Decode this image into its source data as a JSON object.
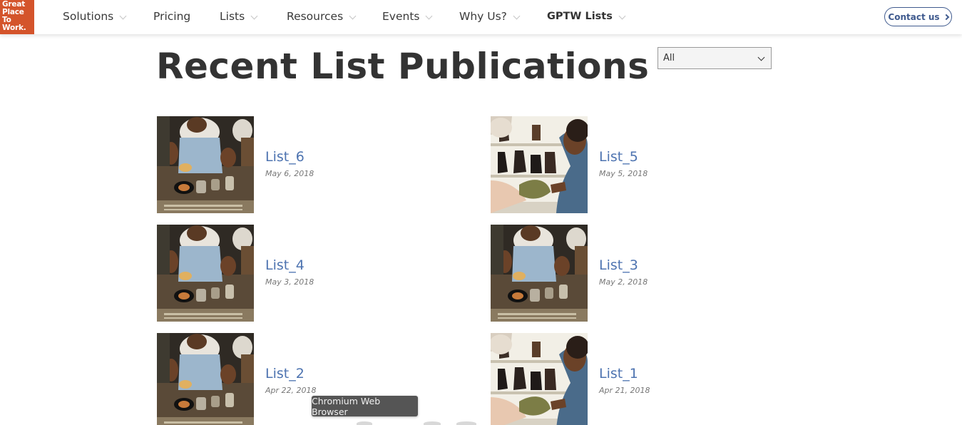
{
  "brand": {
    "logo_lines": [
      "Great",
      "Place",
      "To",
      "Work."
    ],
    "color": "#d4542b"
  },
  "nav": {
    "items": [
      {
        "label": "Solutions",
        "dropdown": true
      },
      {
        "label": "Pricing",
        "dropdown": false
      },
      {
        "label": "Lists",
        "dropdown": true
      },
      {
        "label": "Resources",
        "dropdown": true
      },
      {
        "label": "Events",
        "dropdown": true
      },
      {
        "label": "Why Us?",
        "dropdown": true
      },
      {
        "label": "GPTW Lists",
        "dropdown": true
      }
    ],
    "contact_label": "Contact us"
  },
  "main": {
    "title": "Recent List Publications",
    "filter": {
      "selected": "All"
    },
    "lists": [
      {
        "title": "List_6",
        "date": "May 6, 2018",
        "image": "barista-photo"
      },
      {
        "title": "List_5",
        "date": "May 5, 2018",
        "image": "shoe-store-photo"
      },
      {
        "title": "List_4",
        "date": "May 3, 2018",
        "image": "barista-photo"
      },
      {
        "title": "List_3",
        "date": "May 2, 2018",
        "image": "barista-photo"
      },
      {
        "title": "List_2",
        "date": "Apr 22, 2018",
        "image": "barista-photo"
      },
      {
        "title": "List_1",
        "date": "Apr 21, 2018",
        "image": "shoe-store-photo"
      }
    ]
  },
  "tooltip": {
    "text": "Chromium Web Browser"
  },
  "colors": {
    "link": "#4d73b0",
    "contact": "#3f5a8e",
    "title": "#333333"
  }
}
